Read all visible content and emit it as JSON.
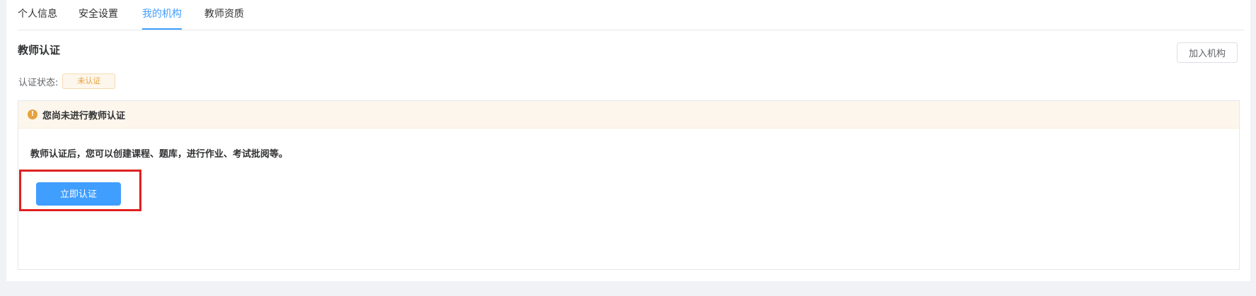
{
  "tabs": [
    {
      "label": "个人信息",
      "active": false
    },
    {
      "label": "安全设置",
      "active": false
    },
    {
      "label": "我的机构",
      "active": true
    },
    {
      "label": "教师资质",
      "active": false
    }
  ],
  "section": {
    "title": "教师认证",
    "join_button": "加入机构"
  },
  "status": {
    "label": "认证状态:",
    "badge": "未认证"
  },
  "alert": {
    "icon": "warning-icon",
    "text": "您尚未进行教师认证"
  },
  "description": "教师认证后，您可以创建课程、题库，进行作业、考试批阅等。",
  "verify_button": "立即认证",
  "colors": {
    "accent": "#409eff",
    "warning": "#e6a23c",
    "highlight": "#e02020"
  }
}
